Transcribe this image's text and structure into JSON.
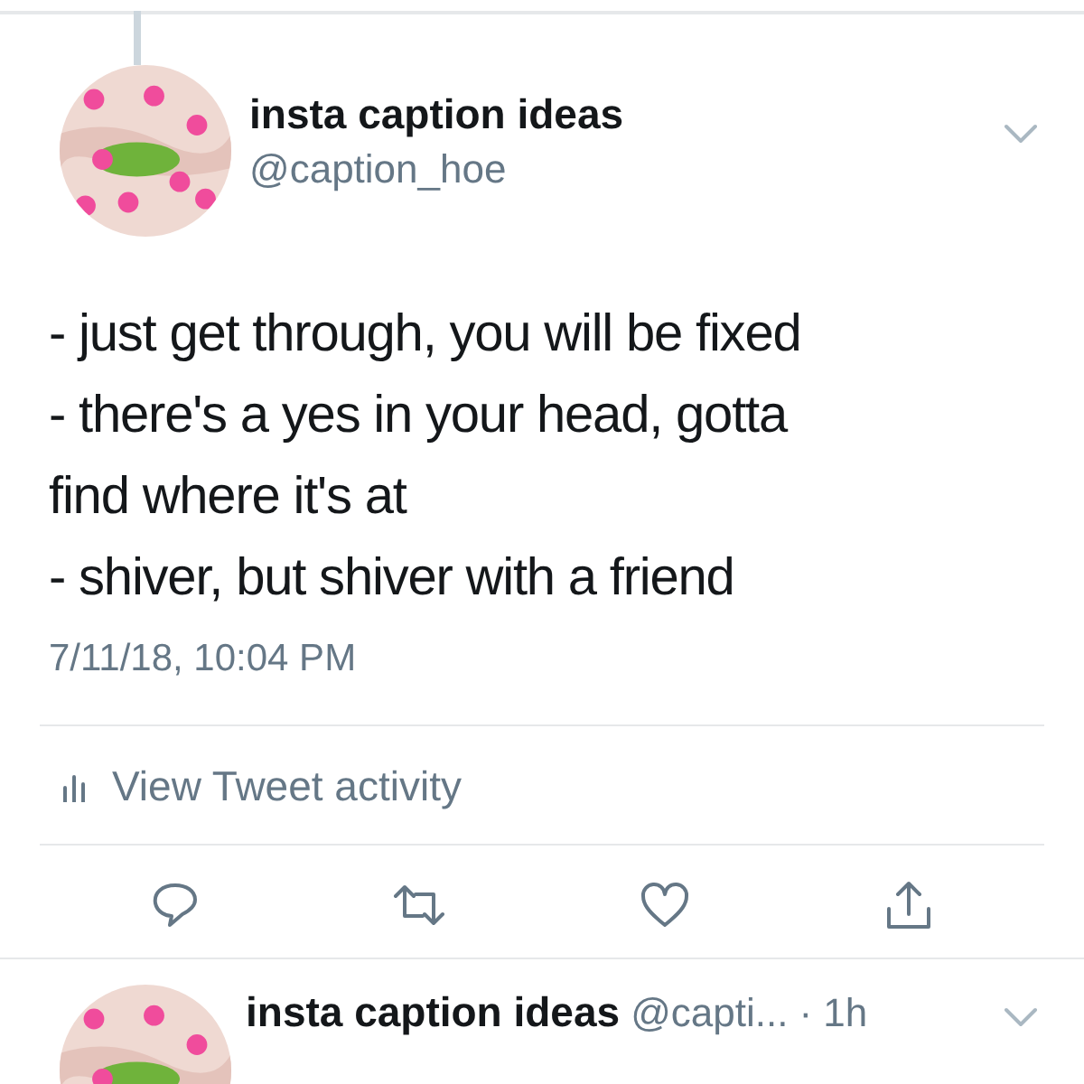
{
  "tweet": {
    "name": "insta caption ideas",
    "handle": "@caption_hoe",
    "text": "- just get through, you will be fixed\n- there's a yes in your head, gotta\nfind where it's at\n- shiver, but shiver with a friend",
    "timestamp": "7/11/18, 10:04 PM",
    "activity": "View Tweet activity"
  },
  "next_tweet": {
    "name": "insta caption ideas",
    "handle": "@capti...",
    "time": "· 1h"
  }
}
